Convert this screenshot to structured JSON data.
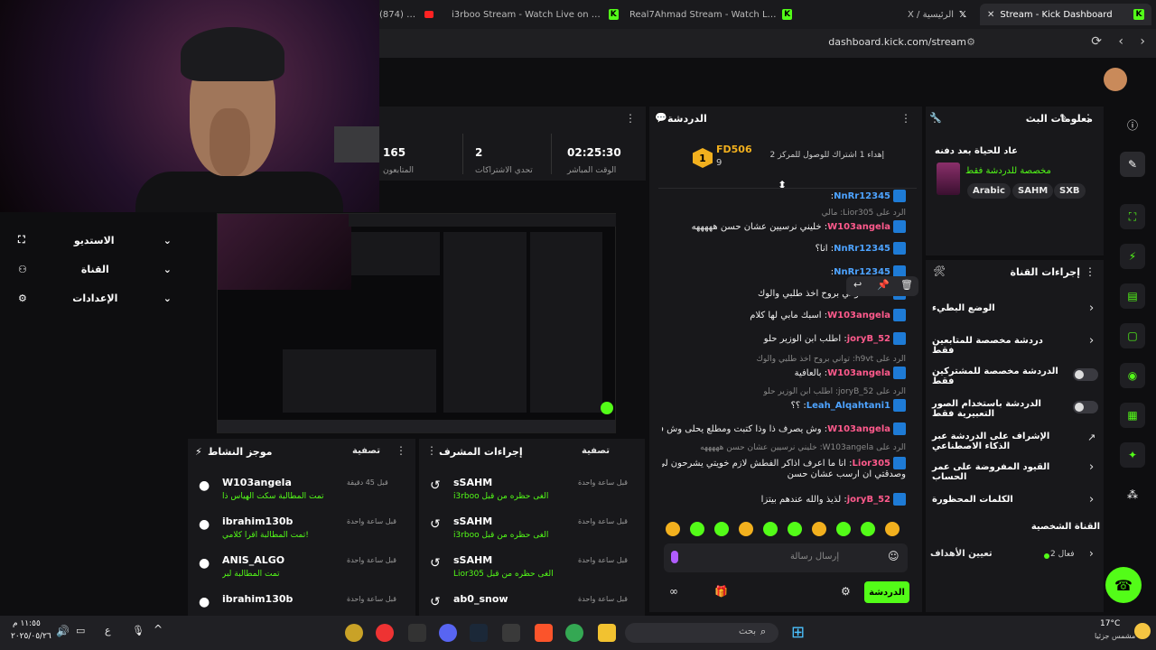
{
  "browser": {
    "tabs": [
      {
        "label": "(874) نيف",
        "active": false
      },
      {
        "label": "i3rboo Stream - Watch Live on Kick",
        "active": false
      },
      {
        "label": "Real7Ahmad Stream - Watch Live on",
        "active": false
      },
      {
        "label": "X / الرئيسية",
        "active": false
      },
      {
        "label": "Stream - Kick Dashboard",
        "active": true
      }
    ],
    "url": "dashboard.kick.com/stream"
  },
  "left_nav": {
    "items": [
      {
        "label": "الاستديو",
        "icon": "studio-icon"
      },
      {
        "label": "القناة",
        "icon": "users-icon"
      },
      {
        "label": "الإعدادات",
        "icon": "gear-icon"
      }
    ]
  },
  "stats": [
    {
      "value": "165",
      "label": "المتابعون"
    },
    {
      "value": "2",
      "label": "تحدي الاشتراكات"
    },
    {
      "value": "02:25:30",
      "label": "الوقت المباشر"
    }
  ],
  "chat": {
    "title": "الدردشة",
    "goal_user": "FD506",
    "goal_rank": "1",
    "goal_count": "9",
    "goal_text": "إهداء 1 اشتراك للوصول للمركز 2",
    "messages": [
      {
        "reply": "",
        "user": "NnRr12345",
        "text": "",
        "color": "blue"
      },
      {
        "reply": "الرد على Lior305: مالي",
        "user": "",
        "text": "",
        "color": ""
      },
      {
        "reply": "",
        "user": "W103angela",
        "text": "خليني نرسيين عشان حسن هههههه",
        "color": "pink"
      },
      {
        "reply": "",
        "user": "NnRr12345",
        "text": "انا؟",
        "color": "blue"
      },
      {
        "reply": "",
        "user": "NnRr12345",
        "text": "",
        "color": "blue"
      },
      {
        "reply": "",
        "user": "h9vt",
        "text": "تواني بروح اخذ طلبي والوك",
        "color": "grey"
      },
      {
        "reply": "",
        "user": "W103angela",
        "text": "اسبك مابي لها كلام",
        "color": "pink"
      },
      {
        "reply": "",
        "user": "joryB_52",
        "text": "اطلب ابن الوزير حلو",
        "color": "pink"
      },
      {
        "reply": "الرد على h9vt: تواني بروح اخذ طلبي والوك",
        "user": "",
        "text": "",
        "color": ""
      },
      {
        "reply": "",
        "user": "W103angela",
        "text": "بالعافية",
        "color": "pink"
      },
      {
        "reply": "الرد على joryB_52: اطلب ابن الوزير حلو",
        "user": "",
        "text": "",
        "color": ""
      },
      {
        "reply": "",
        "user": "Leah_Alqahtani1",
        "text": "؟؟",
        "color": "blue"
      },
      {
        "reply": "",
        "user": "W103angela",
        "text": "وش يصرف ذا وذا كتبت ومطلع يحلى وش فيها",
        "color": "pink"
      },
      {
        "reply": "الرد على W103angela: خليني نرسيين عشان حسن هههههه",
        "user": "",
        "text": "",
        "color": ""
      },
      {
        "reply": "",
        "user": "Lior305",
        "text": "انا ما اعرف اذاكر الفطش لازم خويتي يشرحون لي",
        "color": "pink"
      },
      {
        "reply": "",
        "user": "",
        "text": "وصدقتي ان ارسب عشان حسن",
        "color": ""
      },
      {
        "reply": "",
        "user": "joryB_52",
        "text": "لذيذ والله عندهم بيتزا",
        "color": "pink"
      }
    ],
    "input_placeholder": "إرسال رسالة",
    "send_label": "الدردشة"
  },
  "stream_info": {
    "title": "معلومات البث",
    "stream_title": "عاد للحياة بعد دفنه",
    "category": "مخصصة للدردشة فقط",
    "tags": [
      "Arabic",
      "SAHM",
      "SXB"
    ]
  },
  "channel_actions": {
    "title": "إجراءات القناة",
    "rows": [
      {
        "label": "الوضع البطيء",
        "control": "chevron"
      },
      {
        "label": "دردشة مخصصة للمتابعين فقط",
        "control": "chevron"
      },
      {
        "label": "الدردشة مخصصة للمشتركين فقط",
        "control": "toggle"
      },
      {
        "label": "الدردشة باستخدام الصور التعبيرية فقط",
        "control": "toggle"
      },
      {
        "label": "الإشراف على الدردشة عبر الذكاء الاصطناعي",
        "control": "external"
      },
      {
        "label": "القيود المفروضة على عمر الحساب",
        "control": "chevron"
      },
      {
        "label": "الكلمات المحظورة",
        "control": "chevron"
      }
    ],
    "section_label": "القناة الشخصية",
    "goals_label": "تعيين الأهداف",
    "goals_value": "فعال 2"
  },
  "activity": {
    "title": "موجز النشاط",
    "filter": "تصفية",
    "items": [
      {
        "name": "W103angela",
        "sub": "تمت المطالبة سكت الهياس ذا",
        "time": "قبل 45 دقيقة"
      },
      {
        "name": "ibrahim130b",
        "sub": "تمت المطالبة اقرا كلامي!",
        "time": "قبل ساعة واحدة"
      },
      {
        "name": "ANIS_ALGO",
        "sub": "تمت المطالبة لبر",
        "time": "قبل ساعة واحدة"
      },
      {
        "name": "ibrahim130b",
        "sub": "",
        "time": "قبل ساعة واحدة"
      }
    ]
  },
  "mod_actions": {
    "title": "إجراءات المشرف",
    "filter": "تصفية",
    "items": [
      {
        "name": "sSAHM",
        "sub": "i3rboo ألغى حظره من قبل",
        "time": "قبل ساعة واحدة"
      },
      {
        "name": "sSAHM",
        "sub": "i3rboo ألغى حظره من قبل",
        "time": "قبل ساعة واحدة"
      },
      {
        "name": "sSAHM",
        "sub": "Lior305 ألغى حظره من قبل",
        "time": "قبل ساعة واحدة"
      },
      {
        "name": "ab0_snow",
        "sub": "",
        "time": "قبل ساعة واحدة"
      }
    ]
  },
  "taskbar": {
    "search_placeholder": "بحث",
    "temp": "17°C",
    "weather": "مشمس جزئيا",
    "time": "١١:٥٥ م",
    "date": "٢٠٢٥/٠٥/٢٦",
    "lang": "ع"
  },
  "colors": {
    "accent": "#53fc18",
    "pink": "#ff5a8c",
    "blue": "#4da3ff"
  }
}
